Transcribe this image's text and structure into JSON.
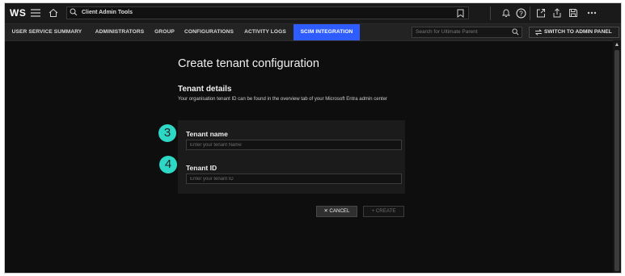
{
  "app": {
    "logo": "WS",
    "search_text": "Client Admin Tools"
  },
  "nav": {
    "tabs": [
      {
        "label": "USER SERVICE SUMMARY"
      },
      {
        "label": "ADMINISTRATORS"
      },
      {
        "label": "GROUP"
      },
      {
        "label": "CONFIGURATIONS"
      },
      {
        "label": "ACTIVITY LOGS"
      },
      {
        "label": "SCIM INTEGRATION",
        "active": true
      }
    ],
    "parent_search_placeholder": "Search for Ultimate Parent",
    "admin_button": "SWITCH TO ADMIN PANEL"
  },
  "page": {
    "title": "Create tenant configuration",
    "section_title": "Tenant details",
    "section_desc": "Your organisation tenant ID can be found in the overview tab of your Microsoft Entra admin center"
  },
  "form": {
    "tenant_name_label": "Tenant name",
    "tenant_name_placeholder": "Enter your tenant Name",
    "tenant_name_value": "",
    "tenant_id_label": "Tenant ID",
    "tenant_id_placeholder": "Enter your tenant ID",
    "tenant_id_value": "",
    "cancel_label": "✕ CANCEL",
    "create_label": "+ CREATE"
  },
  "annotations": {
    "step_3": "3",
    "step_4": "4",
    "badge_color": "#2ed8c6"
  },
  "colors": {
    "accent": "#2e5cff",
    "background": "#0e0e0e"
  }
}
